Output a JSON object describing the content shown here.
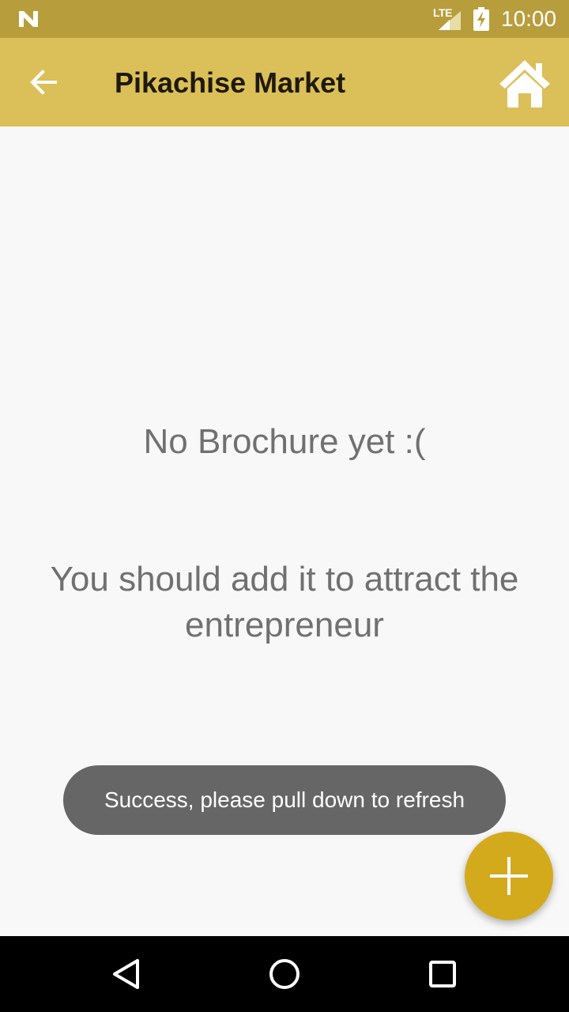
{
  "status_bar": {
    "time": "10:00",
    "network": "LTE",
    "color": "#b89d3c"
  },
  "app_bar": {
    "title": "Pikachise Market",
    "back_icon": "arrow-back-icon",
    "home_icon": "home-icon",
    "color": "#dbbf58"
  },
  "empty_state": {
    "title": "No Brochure yet :(",
    "message": "You should add it to attract the entrepreneur"
  },
  "toast": {
    "message": "Success, please pull down to refresh"
  },
  "fab": {
    "icon": "plus-icon",
    "color": "#d3aa1c"
  },
  "nav_bar": {
    "buttons": [
      "back-triangle-icon",
      "home-circle-icon",
      "recents-square-icon"
    ]
  }
}
